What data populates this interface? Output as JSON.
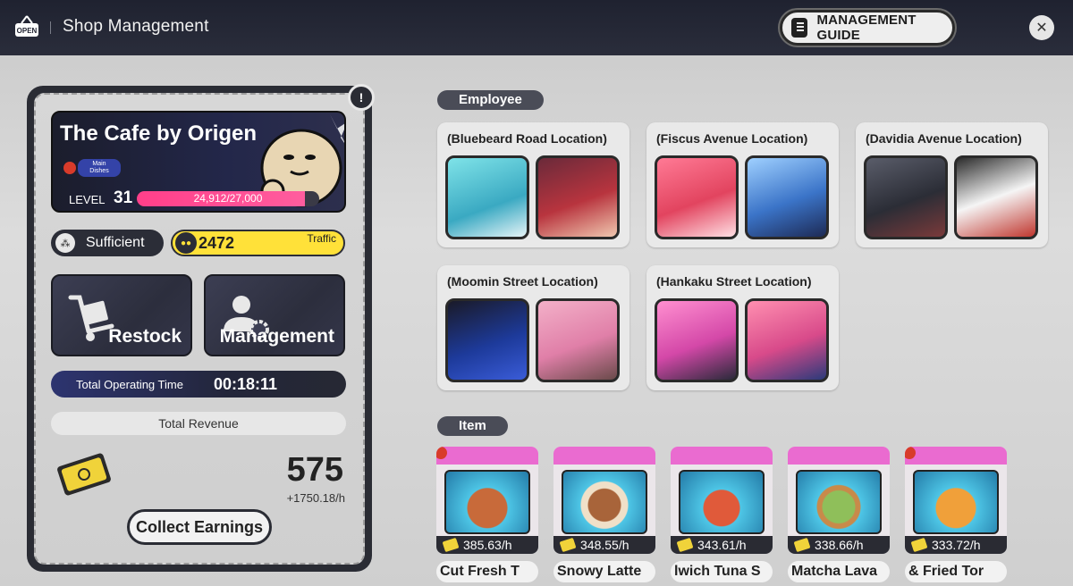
{
  "header": {
    "open_sign": "OPEN",
    "title": "Shop Management",
    "guide_label": "MANAGEMENT GUIDE",
    "close_label": "✕"
  },
  "shop": {
    "name": "The Cafe by Origen",
    "tag_label": "Main Dishes",
    "level_label": "LEVEL",
    "level": "31",
    "xp_text": "24,912/27,000",
    "xp_current": 24912,
    "xp_max": 27000
  },
  "stats": {
    "supply_label": "Sufficient",
    "traffic_value": "2472",
    "traffic_label": "Traffic"
  },
  "actions": {
    "restock_label": "Restock",
    "management_label": "Management"
  },
  "operating": {
    "label": "Total Operating Time",
    "value": "00:18:11"
  },
  "revenue": {
    "label": "Total Revenue",
    "value": "575",
    "rate": "+1750.18/h",
    "collect_label": "Collect Earnings"
  },
  "employee_section": {
    "label": "Employee",
    "locations": [
      {
        "name": "(Bluebeard Road Location)"
      },
      {
        "name": "(Fiscus Avenue Location)"
      },
      {
        "name": "(Davidia Avenue Location)"
      },
      {
        "name": "(Moomin Street Location)"
      },
      {
        "name": "(Hankaku Street Location)"
      }
    ]
  },
  "item_section": {
    "label": "Item",
    "items": [
      {
        "rate": "385.63/h",
        "name": "Cut Fresh     T"
      },
      {
        "rate": "348.55/h",
        "name": "Snowy Latte"
      },
      {
        "rate": "343.61/h",
        "name": "lwich    Tuna S"
      },
      {
        "rate": "338.66/h",
        "name": "Matcha Lava"
      },
      {
        "rate": "333.72/h",
        "name": "& Fried    Tor"
      }
    ]
  },
  "colors": {
    "accent_pink": "#ff3f8a",
    "traffic_yellow": "#ffe139",
    "dark": "#2a2c34"
  }
}
